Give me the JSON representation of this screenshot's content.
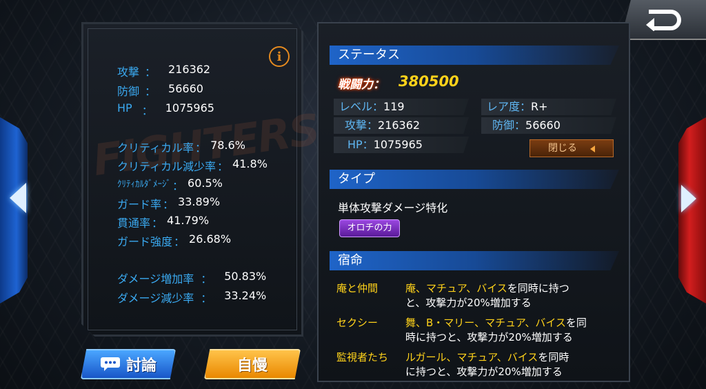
{
  "left_stats": {
    "attack": {
      "label": "攻撃",
      "sep": "：",
      "value": "216362"
    },
    "defense": {
      "label": "防御",
      "sep": "：",
      "value": "56660"
    },
    "hp": {
      "label": "HP",
      "sep": "：",
      "value": "1075965"
    },
    "crit_rate": {
      "label": "クリティカル率",
      "sep": "：",
      "value": "78.6%"
    },
    "crit_reduce": {
      "label": "クリティカル減少率",
      "sep": "：",
      "value": "41.8%"
    },
    "crit_damage": {
      "label": "ｸﾘﾃｨｶﾙﾀﾞﾒｰｼﾞ",
      "sep": "：",
      "value": "60.5%"
    },
    "guard_rate": {
      "label": "ガード率",
      "sep": "：",
      "value": "33.89%"
    },
    "pierce_rate": {
      "label": "貫通率",
      "sep": "：",
      "value": "41.79%"
    },
    "guard_strength": {
      "label": "ガード強度",
      "sep": "：",
      "value": "26.68%"
    },
    "damage_up": {
      "label": "ダメージ増加率",
      "sep": "：",
      "value": "50.83%"
    },
    "damage_down": {
      "label": "ダメージ減少率",
      "sep": "：",
      "value": "33.24%"
    }
  },
  "buttons": {
    "discuss": "討論",
    "boast": "自慢",
    "close": "閉じる"
  },
  "status": {
    "title": "ステータス",
    "power_label": "戦闘力：",
    "power_value": "380500",
    "level_label": "レベル：",
    "level_value": "119",
    "rarity_label": "レア度：",
    "rarity_value": "R+",
    "attack_label": "攻撃：",
    "attack_value": "216362",
    "defense_label": "防御：",
    "defense_value": "56660",
    "hp_label": "HP：",
    "hp_value": "1075965"
  },
  "type_section": {
    "title": "タイプ",
    "description": "単体攻撃ダメージ特化",
    "badge": "オロチの力"
  },
  "fate": {
    "title": "宿命",
    "items": [
      {
        "name": "庵と仲間",
        "line1_hl1": "庵、マチュア、バイス",
        "line1_rest": "を同時に持つ",
        "line2": "と、攻撃力が20%増加する"
      },
      {
        "name": "セクシー",
        "line1_hl1": "舞、B・マリー、マチュア、バイス",
        "line1_rest": "を同",
        "line2": "時に持つと、攻撃力が20%増加する"
      },
      {
        "name": "監視者たち",
        "line1_hl1": "ルガール、マチュア、バイス",
        "line1_rest": "を同時",
        "line2": "に持つと、攻撃力が20%増加する"
      }
    ]
  },
  "colors": {
    "label_blue": "#3aa9f0",
    "highlight_yellow": "#ffd21a",
    "discuss_blue": "#1856c8",
    "boast_orange": "#e98800",
    "type_purple": "#9a48e0"
  }
}
